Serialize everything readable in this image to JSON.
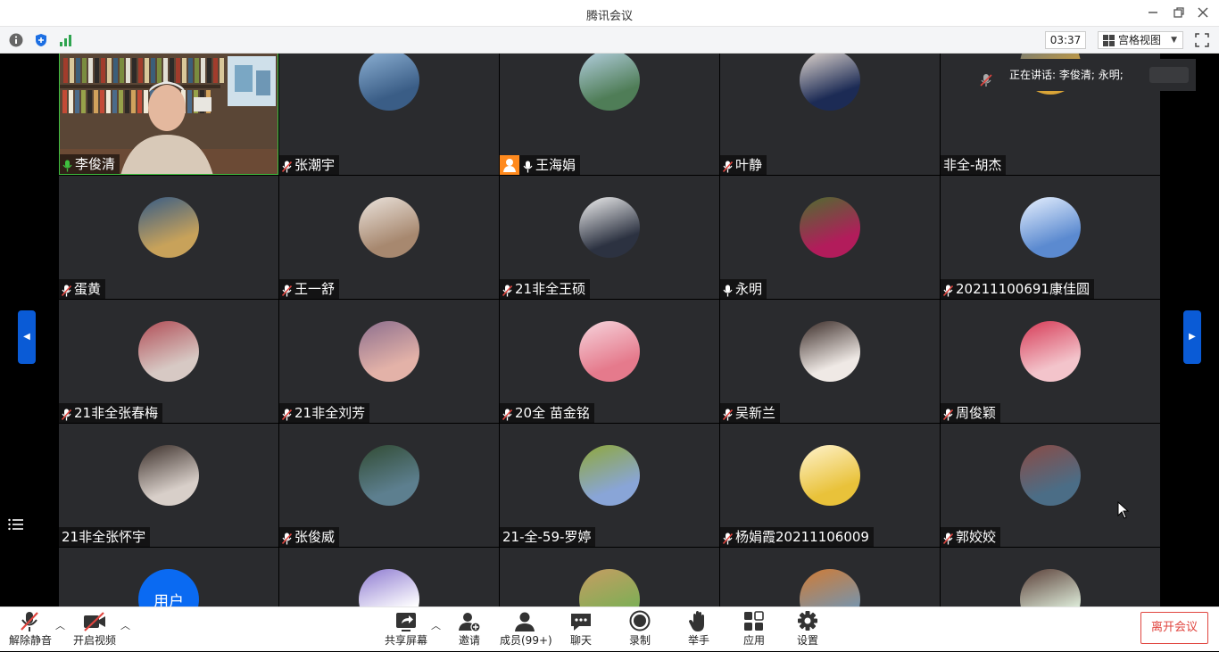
{
  "window": {
    "title": "腾讯会议"
  },
  "toolbar": {
    "timer": "03:37",
    "view_label": "宫格视图"
  },
  "speaker_banner": {
    "text": "正在讲话: 李俊清; 永明;"
  },
  "rows": [
    [
      {
        "name": "李俊清",
        "mic": "on"
      },
      {
        "name": "张潮宇",
        "mic": "muted"
      },
      {
        "name": "王海娟",
        "mic": "on",
        "host": true
      },
      {
        "name": "叶静",
        "mic": "muted"
      },
      {
        "name": "非全-胡杰",
        "mic": "none"
      }
    ],
    [
      {
        "name": "蛋黄",
        "mic": "muted"
      },
      {
        "name": "王一舒",
        "mic": "muted"
      },
      {
        "name": "21非全王硕",
        "mic": "muted"
      },
      {
        "name": "永明",
        "mic": "on"
      },
      {
        "name": "20211100691康佳圆",
        "mic": "muted"
      }
    ],
    [
      {
        "name": "21非全张春梅",
        "mic": "muted"
      },
      {
        "name": "21非全刘芳",
        "mic": "muted"
      },
      {
        "name": "20全 苗金铭",
        "mic": "muted"
      },
      {
        "name": "吴新兰",
        "mic": "muted"
      },
      {
        "name": "周俊颖",
        "mic": "muted"
      }
    ],
    [
      {
        "name": "21非全张怀宇",
        "mic": "none"
      },
      {
        "name": "张俊威",
        "mic": "muted"
      },
      {
        "name": "21-全-59-罗婷",
        "mic": "none"
      },
      {
        "name": "杨娟霞20211106009",
        "mic": "muted"
      },
      {
        "name": "郭姣姣",
        "mic": "muted"
      }
    ],
    [
      {
        "name": "",
        "mic": "none",
        "avatar_text": "用户"
      },
      {
        "name": "",
        "mic": "none"
      },
      {
        "name": "",
        "mic": "none"
      },
      {
        "name": "",
        "mic": "none"
      },
      {
        "name": "",
        "mic": "none"
      }
    ]
  ],
  "bottom": {
    "unmute": "解除静音",
    "start_video": "开启视频",
    "share_screen": "共享屏幕",
    "invite": "邀请",
    "members": "成员(99+)",
    "chat": "聊天",
    "record": "录制",
    "raise_hand": "举手",
    "apps": "应用",
    "settings": "设置",
    "leave": "离开会议"
  },
  "colors": {
    "accent": "#0a5bd6",
    "leave": "#e0453f",
    "mic_on": "#3fbf3f",
    "mic_muted": "#e0453f",
    "host": "#ff8a1e"
  }
}
